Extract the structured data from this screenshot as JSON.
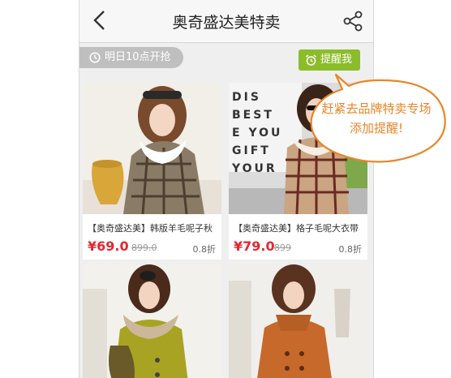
{
  "header": {
    "title": "奥奇盛达美特卖"
  },
  "countdown": {
    "text": "明日10点开抢"
  },
  "remind_button": {
    "label": "提醒我"
  },
  "callout": {
    "line1": "赶紧去品牌特卖专场",
    "line2": "添加提醒!"
  },
  "photo_text": [
    "DIS",
    "BEST",
    "E YOU",
    "GIFT",
    "YOUR"
  ],
  "products": [
    {
      "name": "【奥奇盛达美】韩版羊毛呢子秋",
      "price": "¥69.0",
      "original": "899.0",
      "discount": "0.8折"
    },
    {
      "name": "【奥奇盛达美】格子毛呢大衣带",
      "price": "¥79.0",
      "original": "899",
      "discount": "0.8折"
    },
    {
      "name": "",
      "price": "",
      "original": "",
      "discount": ""
    },
    {
      "name": "",
      "price": "",
      "original": "",
      "discount": ""
    }
  ],
  "colors": {
    "accent_green": "#8bbd2b",
    "price_red": "#e6262e",
    "callout_orange": "#e8862a"
  },
  "icons": [
    "back-arrow-icon",
    "share-icon",
    "clock-icon",
    "alarm-icon"
  ]
}
